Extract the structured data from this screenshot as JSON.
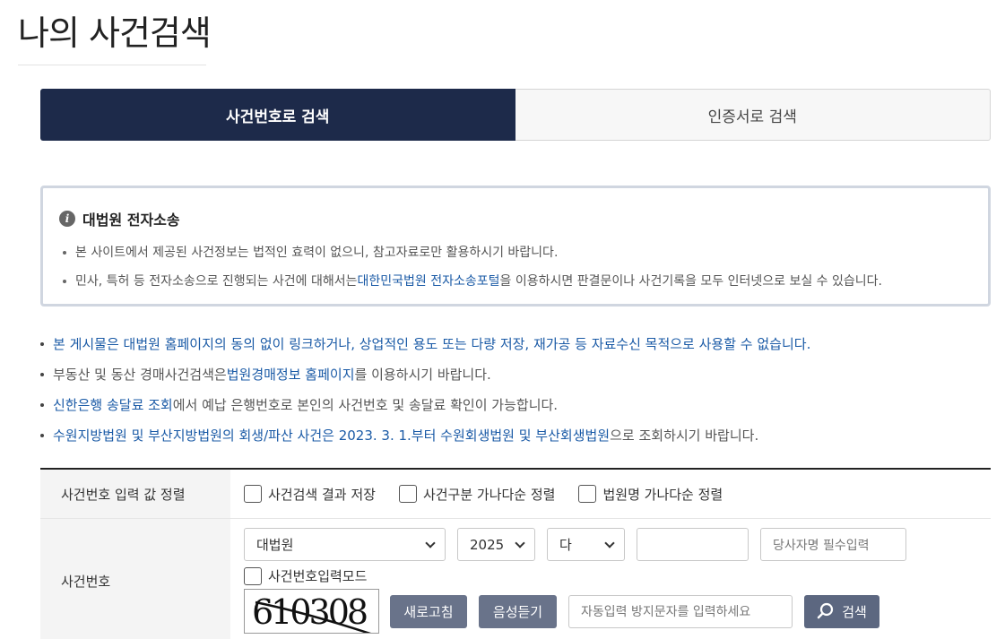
{
  "page": {
    "title": "나의 사건검색"
  },
  "tabs": [
    {
      "label": "사건번호로 검색",
      "active": true
    },
    {
      "label": "인증서로 검색",
      "active": false
    }
  ],
  "notice": {
    "title": "대법원 전자소송",
    "line1": "본 사이트에서 제공된 사건정보는 법적인 효력이 없으니, 참고자료로만 활용하시기 바랍니다.",
    "line2_pre": "민사, 특허 등 전자소송으로 진행되는 사건에 대해서는 ",
    "line2_link": "대한민국법원 전자소송포털",
    "line2_post": "을 이용하시면 판결문이나 사건기록을 모두 인터넷으로 보실 수 있습니다."
  },
  "info": {
    "line1": "본 게시물은 대법원 홈페이지의 동의 없이 링크하거나, 상업적인 용도 또는 다량 저장, 재가공 등 자료수신 목적으로 사용할 수 없습니다.",
    "line2_pre": "부동산 및 동산 경매사건검색은 ",
    "line2_link": "법원경매정보 홈페이지",
    "line2_post": "를 이용하시기 바랍니다.",
    "line3_link": "신한은행 송달료 조회",
    "line3_post": "에서 예납 은행번호로 본인의 사건번호 및 송달료 확인이 가능합니다.",
    "line4_blue": "수원지방법원 및 부산지방법원의 회생/파산 사건은 2023. 3. 1.부터 수원회생법원 및 부산회생법원",
    "line4_post": "으로 조회하시기 바랍니다."
  },
  "form": {
    "sort_label": "사건번호 입력 값 정렬",
    "checks": [
      "사건검색 결과 저장",
      "사건구분 가나다순 정렬",
      "법원명 가나다순 정렬"
    ],
    "case_label": "사건번호",
    "court_value": "대법원",
    "year_value": "2025",
    "type_value": "다",
    "number_value": "",
    "party_placeholder": "당사자명 필수입력",
    "input_mode_label": "사건번호입력모드",
    "captcha_text": "610308",
    "refresh_label": "새로고침",
    "audio_label": "음성듣기",
    "captcha_placeholder": "자동입력 방지문자를 입력하세요",
    "search_label": "검색"
  }
}
